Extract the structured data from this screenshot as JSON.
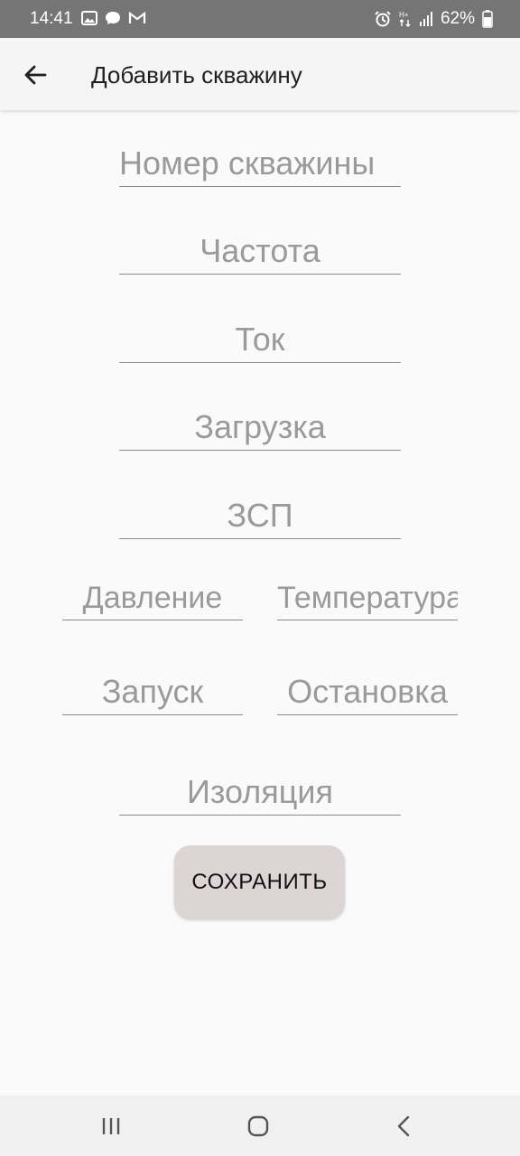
{
  "status_bar": {
    "time": "14:41",
    "battery": "62%",
    "left_icons": [
      "image-icon",
      "chat-icon",
      "gmail-icon"
    ],
    "right_icons": [
      "alarm-icon",
      "data-icon",
      "signal-icon",
      "battery-icon"
    ]
  },
  "app_bar": {
    "back_icon": "arrow-left-icon",
    "title": "Добавить скважину"
  },
  "form": {
    "well_number": {
      "placeholder": "Номер скважины",
      "value": ""
    },
    "frequency": {
      "placeholder": "Частота",
      "value": ""
    },
    "current": {
      "placeholder": "Ток",
      "value": ""
    },
    "load": {
      "placeholder": "Загрузка",
      "value": ""
    },
    "zsp": {
      "placeholder": "ЗСП",
      "value": ""
    },
    "pressure": {
      "placeholder": "Давление",
      "value": ""
    },
    "temperature": {
      "placeholder": "Температура",
      "value": ""
    },
    "start": {
      "placeholder": "Запуск",
      "value": ""
    },
    "stop": {
      "placeholder": "Остановка",
      "value": ""
    },
    "insulation": {
      "placeholder": "Изоляция",
      "value": ""
    }
  },
  "save_button": {
    "label": "СОХРАНИТЬ"
  },
  "nav_bar": {
    "icons": [
      "recent-apps-icon",
      "home-icon",
      "back-icon"
    ]
  },
  "colors": {
    "status_bar": "#757575",
    "app_bar": "#f5f5f5",
    "button": "#ddd5d5",
    "background": "#fafafa"
  }
}
